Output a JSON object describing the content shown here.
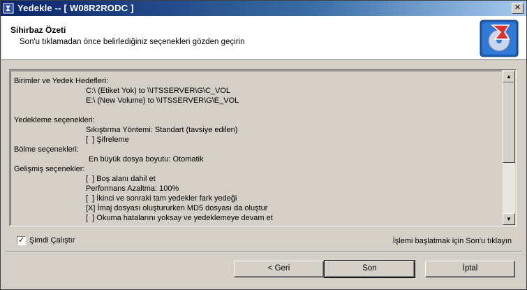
{
  "window": {
    "title": "Yedekle -- [ W08R2RODC ]"
  },
  "header": {
    "title": "Sihirbaz Özeti",
    "subtitle": "Son'u tıklamadan önce belirlediğiniz seçenekleri gözden geçirin"
  },
  "summary": {
    "lines": [
      "Birimler ve Yedek Hedefleri:",
      "C:\\ (Etiket Yok) to \\\\ITSSERVER\\G\\C_VOL",
      "E:\\ (New Volume) to \\\\ITSSERVER\\G\\E_VOL",
      "Yedekleme seçenekleri:",
      "Sıkıştırma Yöntemi: Standart (tavsiye edilen)",
      "[  ] Şifreleme",
      "Bölme seçenekleri:",
      "En büyük dosya boyutu: Otomatik",
      "Gelişmiş seçenekler:",
      "[  ] Boş alanı dahil et",
      "Performans Azaltma: 100%",
      "[  ] İkinci ve sonraki tam yedekler fark yedeği",
      "[X] İmaj dosyası oluştururken MD5 dosyası da oluştur",
      "[  ] Okuma hatalarını yoksay ve yedeklemeye devam et"
    ]
  },
  "options": {
    "run_now_label": "Şimdi Çalıştır",
    "run_now_checked": "✓"
  },
  "hint": "İşlemi başlatmak için Son'u tıklayın",
  "buttons": {
    "back": "< Geri",
    "finish": "Son",
    "cancel": "İptal"
  }
}
